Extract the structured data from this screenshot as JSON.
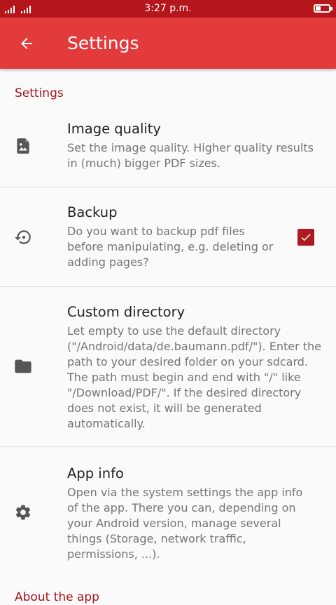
{
  "status_bar": {
    "time": "3:27 p.m.",
    "signal_icon": "signal-bars-icon",
    "battery_icon": "battery-icon"
  },
  "app_bar": {
    "title": "Settings",
    "back_icon": "arrow-back-icon",
    "color": "#e33a3c"
  },
  "category_settings": "Settings",
  "preferences": [
    {
      "icon": "image-icon",
      "title": "Image quality",
      "summary": "Set the image quality. Higher quality results in (much) bigger PDF sizes."
    },
    {
      "icon": "restore-icon",
      "title": "Backup",
      "summary": "Do you want to backup pdf files before manipulating, e.g. deleting or adding pages?",
      "checked": true
    },
    {
      "icon": "folder-icon",
      "title": "Custom directory",
      "summary": "Let empty to use the default directory (\"/Android/data/de.baumann.pdf/\"). Enter the path to your desired folder on your sdcard. The path must begin and end with \"/\" like \"/Download/PDF/\". If the desired directory does not exist, it will be generated automatically."
    },
    {
      "icon": "gear-icon",
      "title": "App info",
      "summary": "Open via the system settings the app info of the app. There you can, depending on your Android version, manage several things (Storage, network traffic, permissions, ...)."
    }
  ],
  "category_about": "About the app",
  "colors": {
    "status_bar": "#b5161c",
    "accent": "#a5151c",
    "checkbox": "#ac1a22"
  }
}
